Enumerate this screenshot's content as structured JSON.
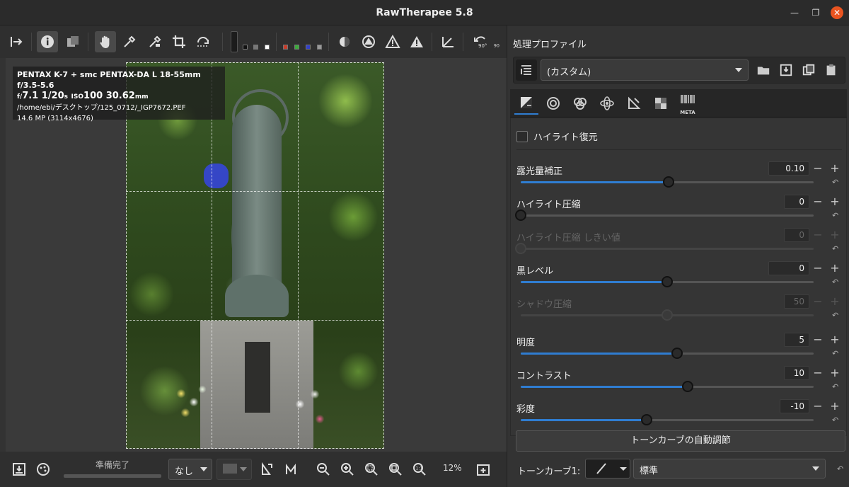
{
  "window": {
    "title": "RawTherapee 5.8"
  },
  "info_overlay": {
    "line1": "PENTAX K-7 + smc PENTAX-DA L 18-55mm f/3.5-5.6",
    "aperture_prefix": "f/",
    "aperture": "7.1",
    "shutter": "1/20",
    "shutter_unit": "s",
    "iso_prefix": "ISO",
    "iso": "100",
    "focal": "30.62",
    "focal_unit": "mm",
    "path": "/home/ebi/デスクトップ/125_0712/_IGP7672.PEF",
    "resolution": "14.6 MP (3114x4676)"
  },
  "statusbar": {
    "status_text": "準備完了",
    "combo_value": "なし",
    "zoom_text": "12%"
  },
  "panel": {
    "profile_title": "処理プロファイル",
    "profile_value": "(カスタム)",
    "tab_meta_label": "META",
    "highlight_recovery": "ハイライト復元",
    "params": [
      {
        "name": "露光量補正",
        "value": "0.10",
        "level": 0.505,
        "enabled": true
      },
      {
        "name": "ハイライト圧縮",
        "value": "0",
        "level": 0.0,
        "enabled": true
      },
      {
        "name": "ハイライト圧縮 しきい値",
        "value": "0",
        "level": 0.0,
        "enabled": false
      },
      {
        "name": "黒レベル",
        "value": "0",
        "level": 0.5,
        "enabled": true
      },
      {
        "name": "シャドウ圧縮",
        "value": "50",
        "level": 0.5,
        "enabled": false
      },
      {
        "name": "明度",
        "value": "5",
        "level": 0.535,
        "enabled": true
      },
      {
        "name": "コントラスト",
        "value": "10",
        "level": 0.57,
        "enabled": true
      },
      {
        "name": "彩度",
        "value": "-10",
        "level": 0.43,
        "enabled": true
      }
    ],
    "auto_button": "トーンカーブの自動調節",
    "tonecurve_label": "トーンカーブ1:",
    "tonecurve_value": "標準"
  },
  "colors": {
    "accent": "#2f7dd1",
    "close": "#e95420",
    "clip_overlay": "#3546d8"
  }
}
